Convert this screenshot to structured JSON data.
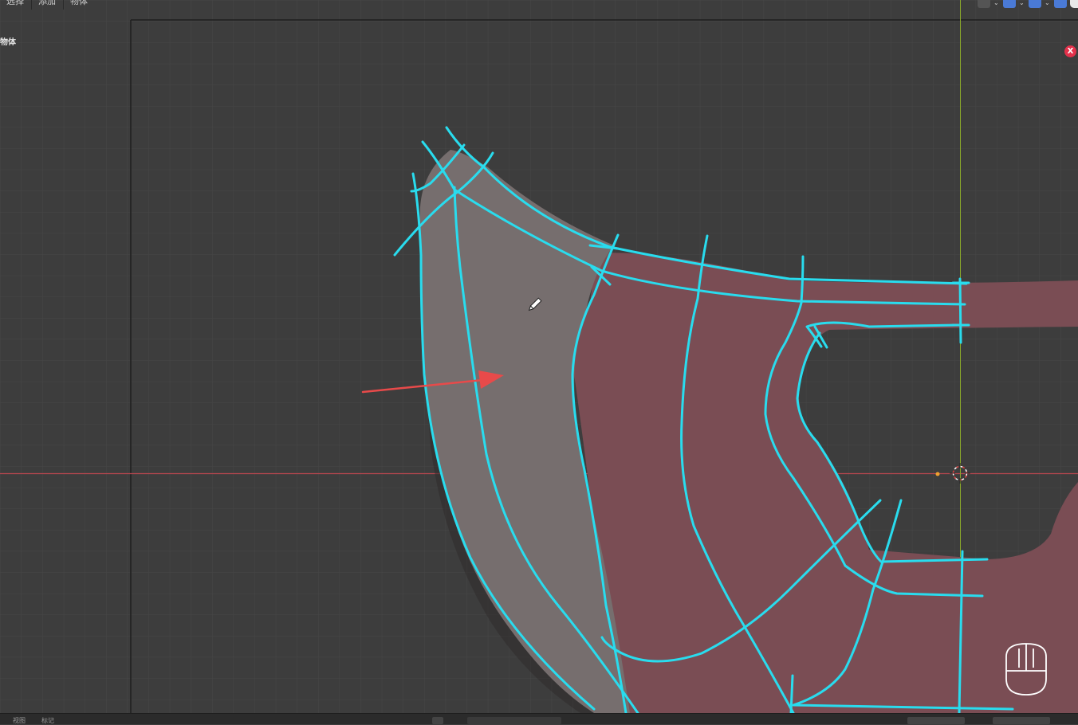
{
  "header": {
    "menu": [
      "选择",
      "添加",
      "物体"
    ],
    "icons": [
      "cursor-icon",
      "chevron-down-icon",
      "snap-icon",
      "chevron-down-icon",
      "overlay-icon",
      "chevron-down-icon",
      "xray-icon",
      "shading-icon"
    ]
  },
  "sidebar": {
    "label": "物体"
  },
  "overlay": {
    "close_label": "X"
  },
  "footer": {
    "left_items": [
      "视图",
      "标记"
    ]
  },
  "colors": {
    "background": "#3d3d3d",
    "grid_minor": "#444444",
    "grid_major": "#4c4c4c",
    "x_axis": "#b8464f",
    "y_axis": "#8aa82a",
    "curve": "#29dcee",
    "fill_gray": "#766e6e",
    "fill_red": "#7a4d54",
    "arrow": "#e84a4a",
    "close_badge": "#e4314b"
  }
}
